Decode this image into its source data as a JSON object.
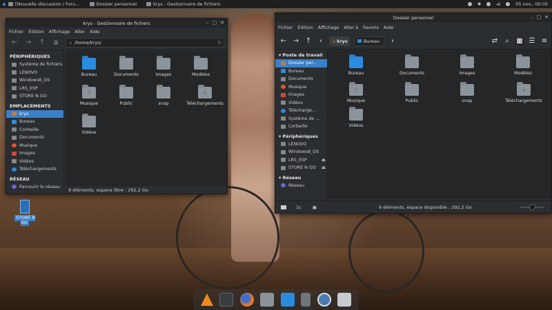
{
  "top_panel": {
    "tasks": [
      "[Nouvelle discussion / Foru...",
      "Dossier personnel",
      "krys - Gestionnaire de fichiers"
    ],
    "clock": "05 nov., 00:05"
  },
  "left_window": {
    "title": "krys - Gestionnaire de fichiers",
    "menu": [
      "Fichier",
      "Édition",
      "Affichage",
      "Aller",
      "Aide"
    ],
    "path": "/home/krys/",
    "sections": [
      {
        "title": "PÉRIPHÉRIQUES",
        "items": [
          "Système de fichiers",
          "LENOVO",
          "Windows8_OS",
          "LRS_ESP",
          "STORE N GO"
        ]
      },
      {
        "title": "EMPLACEMENTS",
        "items": [
          "krys",
          "Bureau",
          "Corbeille",
          "Documents",
          "Musique",
          "Images",
          "Vidéos",
          "Téléchargements"
        ]
      },
      {
        "title": "RÉSEAU",
        "items": [
          "Parcourir le réseau"
        ]
      }
    ],
    "files": [
      "Bureau",
      "Documents",
      "Images",
      "Modèles",
      "Musique",
      "Public",
      "snap",
      "Téléchargements",
      "Vidéos"
    ],
    "status": "9 éléments, espace libre : 292,2 Go"
  },
  "right_window": {
    "title": "Dossier personnel",
    "menu": [
      "Fichier",
      "Édition",
      "Affichage",
      "Aller à",
      "Favoris",
      "Aide"
    ],
    "crumbs": [
      "krys",
      "Bureau"
    ],
    "sections": [
      {
        "title": "Poste de travail",
        "items": [
          "Dossier per...",
          "Bureau",
          "Documents",
          "Musique",
          "Images",
          "Vidéos",
          "Télécharge...",
          "Système de ...",
          "Corbeille"
        ]
      },
      {
        "title": "Périphériques",
        "items": [
          "LENOVO",
          "Windows8_OS",
          "LRS_ESP",
          "STORE N GO"
        ]
      },
      {
        "title": "Réseau",
        "items": [
          "Réseau"
        ]
      }
    ],
    "files": [
      "Bureau",
      "Documents",
      "Images",
      "Modèles",
      "Musique",
      "Public",
      "snap",
      "Téléchargements",
      "Vidéos"
    ],
    "status": "9 éléments, espace disponible : 292,2 Go"
  },
  "desktop_icon": "STORE N GO",
  "icons": {
    "folder": "folder-icon",
    "drive": "drive-icon"
  },
  "colors": {
    "accent": "#3a80c9",
    "window_bg": "#2b2e31",
    "content_bg": "#242628",
    "folder_blue": "#2a8ce0",
    "folder_gray": "#8c949b"
  }
}
